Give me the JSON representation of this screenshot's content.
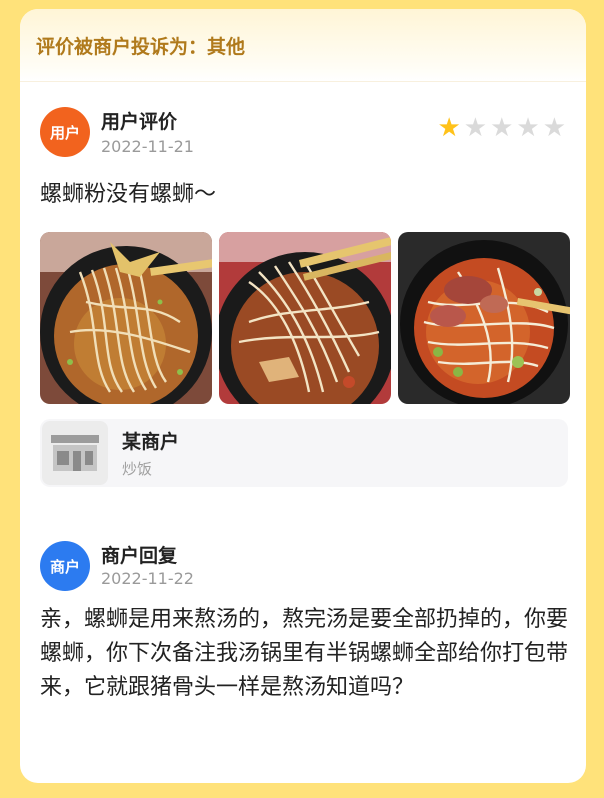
{
  "banner": {
    "text": "评价被商户投诉为：其他"
  },
  "review": {
    "avatar_label": "用户",
    "name": "用户评价",
    "date": "2022-11-21",
    "rating": 1,
    "rating_max": 5,
    "text": "螺蛳粉没有螺蛳～",
    "photos": [
      {
        "icon": "noodle-photo-1"
      },
      {
        "icon": "noodle-photo-2"
      },
      {
        "icon": "noodle-photo-3"
      }
    ]
  },
  "shop": {
    "icon": "storefront-icon",
    "name": "某商户",
    "category": "炒饭"
  },
  "reply": {
    "avatar_label": "商户",
    "name": "商户回复",
    "date": "2022-11-22",
    "text": "亲，螺蛳是用来熬汤的，熬完汤是要全部扔掉的，你要螺蛳，你下次备注我汤锅里有半锅螺蛳全部给你打包带来，它就跟猪骨头一样是熬汤知道吗？"
  },
  "colors": {
    "page_bg": "#ffe27a",
    "banner_text": "#b07a1c",
    "user_avatar": "#f2631e",
    "merchant_avatar": "#2c7bf0",
    "star_on": "#ffc21a",
    "star_off": "#dadada"
  }
}
